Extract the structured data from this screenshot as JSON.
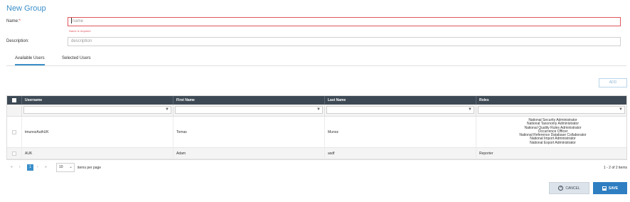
{
  "form": {
    "title": "New Group",
    "name_label": "Name:",
    "name_required_mark": "*",
    "name_placeholder": "name",
    "name_error": "Name is required",
    "description_label": "Description:",
    "description_placeholder": "description"
  },
  "tabs": [
    {
      "label": "Available Users",
      "active": true
    },
    {
      "label": "Selected Users",
      "active": false
    }
  ],
  "add_button": "ADD",
  "grid": {
    "columns": [
      "Username",
      "First Name",
      "Last Name",
      "Roles"
    ],
    "rows": [
      {
        "username": "tmunozAuthUK",
        "first_name": "Tomas",
        "last_name": "Munoz",
        "roles": [
          "National Security Administrator",
          "National Taxonomy Administrator",
          "National Quality Rules Administrator",
          "Occurrence Officer",
          "National Reference Database Collaborator",
          "National Import Administrator",
          "National Export Administrator"
        ]
      },
      {
        "username": "AUK",
        "first_name": "Adam",
        "last_name": "asdf",
        "roles": [
          "Reporter"
        ]
      }
    ]
  },
  "pager": {
    "first": "«",
    "prev": "‹",
    "current_page": "1",
    "next": "›",
    "last": "»",
    "page_size": "10",
    "items_per_page_label": "items per page",
    "count": "1 - 2 of 2 items"
  },
  "buttons": {
    "cancel": "CANCEL",
    "save": "SAVE"
  },
  "colors": {
    "accent": "#3a8fc9",
    "header_bg": "#3d4a55",
    "error": "#e0565e"
  }
}
